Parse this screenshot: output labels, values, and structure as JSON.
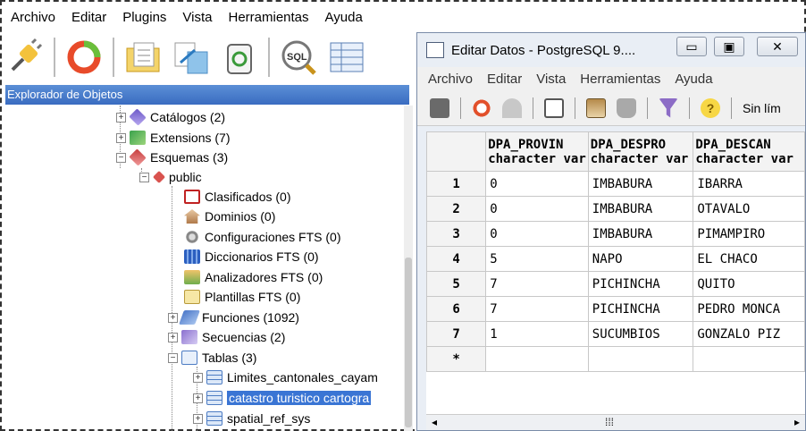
{
  "main": {
    "menu": [
      "Archivo",
      "Editar",
      "Plugins",
      "Vista",
      "Herramientas",
      "Ayuda"
    ],
    "toolbar_icons": [
      "plug-icon",
      "refresh-icon",
      "folder-properties-icon",
      "export-icon",
      "delete-icon",
      "sql-icon",
      "grid-icon"
    ],
    "explorer_title": "Explorador de Objetos",
    "tree": {
      "catalogos": "Catálogos (2)",
      "extensions": "Extensions (7)",
      "esquemas": "Esquemas (3)",
      "public": "public",
      "clasificados": "Clasificados (0)",
      "dominios": "Dominios (0)",
      "config_fts": "Configuraciones FTS (0)",
      "dicc_fts": "Diccionarios FTS (0)",
      "anal_fts": "Analizadores FTS (0)",
      "plant_fts": "Plantillas FTS (0)",
      "funciones": "Funciones (1092)",
      "secuencias": "Secuencias (2)",
      "tablas": "Tablas (3)",
      "t1": "Limites_cantonales_cayam",
      "t2": "catastro turistico cartogra",
      "t3": "spatial_ref_sys"
    }
  },
  "editor": {
    "title": "Editar Datos - PostgreSQL 9....",
    "menu": [
      "Archivo",
      "Editar",
      "Vista",
      "Herramientas",
      "Ayuda"
    ],
    "limit_label": "Sin lím",
    "columns": [
      {
        "name": "DPA_PROVIN",
        "type": "character var"
      },
      {
        "name": "DPA_DESPRO",
        "type": "character var"
      },
      {
        "name": "DPA_DESCAN",
        "type": "character var"
      }
    ],
    "rows": [
      {
        "n": "1",
        "c1": "0",
        "c2": "IMBABURA",
        "c3": "IBARRA"
      },
      {
        "n": "2",
        "c1": "0",
        "c2": "IMBABURA",
        "c3": "OTAVALO"
      },
      {
        "n": "3",
        "c1": "0",
        "c2": "IMBABURA",
        "c3": "PIMAMPIRO"
      },
      {
        "n": "4",
        "c1": "5",
        "c2": "NAPO",
        "c3": "EL CHACO"
      },
      {
        "n": "5",
        "c1": "7",
        "c2": "PICHINCHA",
        "c3": "QUITO"
      },
      {
        "n": "6",
        "c1": "7",
        "c2": "PICHINCHA",
        "c3": "PEDRO MONCA"
      },
      {
        "n": "7",
        "c1": "1",
        "c2": "SUCUMBIOS",
        "c3": "GONZALO PIZ"
      },
      {
        "n": "*",
        "c1": "",
        "c2": "",
        "c3": ""
      }
    ]
  }
}
